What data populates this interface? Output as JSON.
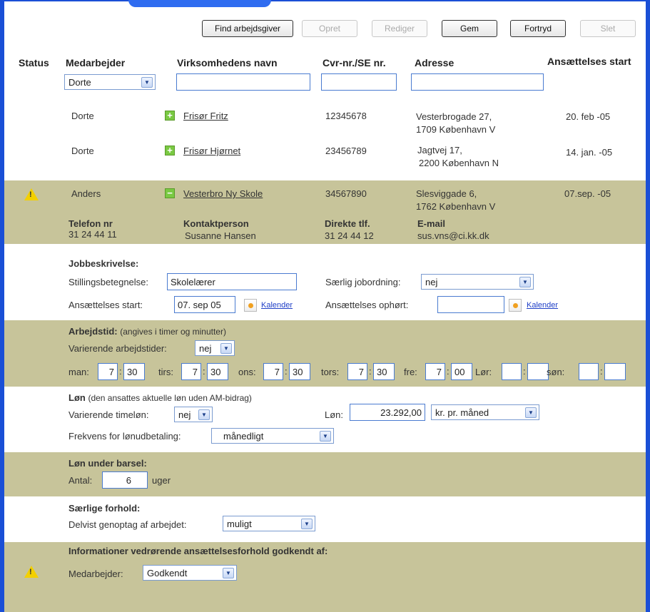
{
  "toolbar": {
    "find": "Find arbejdsgiver",
    "opret": "Opret",
    "rediger": "Rediger",
    "gem": "Gem",
    "fortryd": "Fortryd",
    "slet": "Slet"
  },
  "columns": {
    "status": "Status",
    "medarbejder": "Medarbejder",
    "virksomhed": "Virksomhedens navn",
    "cvr": "Cvr-nr./SE nr.",
    "adresse": "Adresse",
    "start": "Ansættelses start"
  },
  "filter": {
    "medarbejder": "Dorte"
  },
  "rows": [
    {
      "name": "Dorte",
      "company": "Frisør Fritz",
      "cvr": "12345678",
      "addr1": "Vesterbrogade 27,",
      "addr2": "1709 København V",
      "start": "20. feb -05"
    },
    {
      "name": "Dorte",
      "company": "Frisør Hjørnet",
      "cvr": "23456789",
      "addr1": "Jagtvej 17,",
      "addr2": "2200 København N",
      "start": "14. jan. -05"
    },
    {
      "name": "Anders",
      "company": "Vesterbro Ny Skole",
      "cvr": "34567890",
      "addr1": "Slesviggade 6,",
      "addr2": "1762 København V",
      "start": "07.sep. -05"
    }
  ],
  "contact": {
    "tel_label": "Telefon nr",
    "tel": "31 24 44 11",
    "person_label": "Kontaktperson",
    "person": "Susanne Hansen",
    "direct_label": "Direkte tlf.",
    "direct": "31 24 44 12",
    "email_label": "E-mail",
    "email": "sus.vns@ci.kk.dk"
  },
  "job": {
    "title": "Jobbeskrivelse:",
    "stilling_label": "Stillingsbetegnelse:",
    "stilling": "Skolelærer",
    "saerlig_label": "Særlig jobordning:",
    "saerlig": "nej",
    "start_label": "Ansættelses start:",
    "start": "07. sep 05",
    "kalender": "Kalender",
    "ophort_label": "Ansættelses ophørt:"
  },
  "arbejdstid": {
    "title": "Arbejdstid:",
    "note": "(angives i timer og minutter)",
    "var_label": "Varierende arbejdstider:",
    "var": "nej",
    "days": [
      {
        "d": "man:",
        "h": "7",
        "m": "30"
      },
      {
        "d": "tirs:",
        "h": "7",
        "m": "30"
      },
      {
        "d": "ons:",
        "h": "7",
        "m": "30"
      },
      {
        "d": "tors:",
        "h": "7",
        "m": "30"
      },
      {
        "d": "fre:",
        "h": "7",
        "m": "00"
      },
      {
        "d": "Lør:",
        "h": "",
        "m": ""
      },
      {
        "d": "søn:",
        "h": "",
        "m": ""
      }
    ]
  },
  "lon": {
    "title": "Løn",
    "note": "(den ansattes aktuelle løn uden AM-bidrag)",
    "var_label": "Varierende timeløn:",
    "var": "nej",
    "lon_label": "Løn:",
    "lon": "23.292,00",
    "unit": "kr. pr. måned",
    "frek_label": "Frekvens for lønudbetaling:",
    "frek": "månedligt"
  },
  "barsel": {
    "title": "Løn under barsel:",
    "antal_label": "Antal:",
    "antal": "6",
    "unit": "uger"
  },
  "saerlige": {
    "title": "Særlige forhold:",
    "label": "Delvist genoptag af arbejdet:",
    "value": "muligt"
  },
  "godkendt": {
    "title": "Informationer vedrørende ansættelsesforhold godkendt af:",
    "label": "Medarbejder:",
    "value": "Godkendt"
  },
  "colors": {
    "border": "#1a4fd6",
    "band": "#c7c49a",
    "link": "#1f3fc7"
  }
}
